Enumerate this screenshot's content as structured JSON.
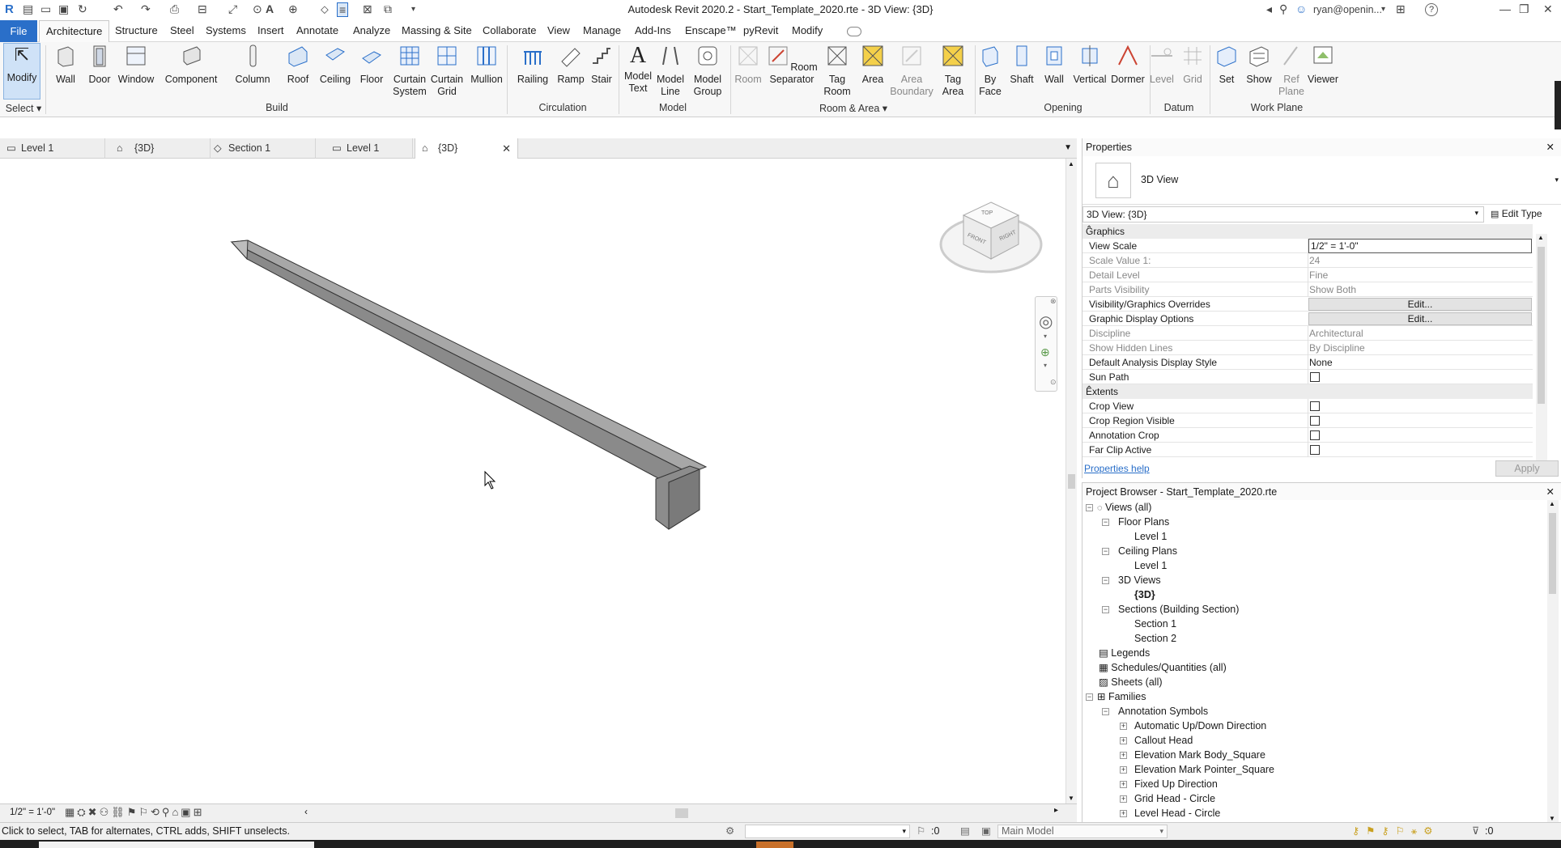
{
  "titlebar": {
    "title": "Autodesk Revit 2020.2 - Start_Template_2020.rte - 3D View: {3D}",
    "user": "ryan@openin...",
    "help": "?"
  },
  "ribbon_tabs": [
    "File",
    "Architecture",
    "Structure",
    "Steel",
    "Systems",
    "Insert",
    "Annotate",
    "Analyze",
    "Massing & Site",
    "Collaborate",
    "View",
    "Manage",
    "Add-Ins",
    "Enscape™",
    "pyRevit",
    "Modify"
  ],
  "tools": {
    "modify": "Modify",
    "wall": "Wall",
    "door": "Door",
    "window": "Window",
    "component": "Component",
    "column": "Column",
    "roof": "Roof",
    "ceiling": "Ceiling",
    "floor": "Floor",
    "curtain_system": "Curtain System",
    "curtain_grid": "Curtain Grid",
    "mullion": "Mullion",
    "railing": "Railing",
    "ramp": "Ramp",
    "stair": "Stair",
    "model_text": "Model Text",
    "model_line": "Model Line",
    "model_group": "Model Group",
    "room": "Room",
    "room_separator": "Room Separator",
    "tag_room": "Tag Room",
    "area": "Area",
    "area_boundary": "Area Boundary",
    "tag_area": "Tag Area",
    "by_face": "By Face",
    "shaft": "Shaft",
    "wall_opening": "Wall",
    "vertical": "Vertical",
    "dormer": "Dormer",
    "level": "Level",
    "grid": "Grid",
    "set": "Set",
    "show": "Show",
    "ref_plane": "Ref Plane",
    "viewer": "Viewer"
  },
  "groups": {
    "select": "Select",
    "build": "Build",
    "circulation": "Circulation",
    "model": "Model",
    "room_area": "Room & Area",
    "opening": "Opening",
    "datum": "Datum",
    "work_plane": "Work Plane"
  },
  "view_tabs": [
    "Level 1",
    "{3D}",
    "Section 1",
    "Level 1",
    "{3D}"
  ],
  "viewcube": {
    "top": "TOP",
    "front": "FRONT",
    "right": "RIGHT"
  },
  "properties": {
    "title": "Properties",
    "type_name": "3D View",
    "selector": "3D View: {3D}",
    "edit_type": "Edit Type",
    "sections": {
      "graphics": "Graphics",
      "extents": "Extents"
    },
    "rows": {
      "view_scale": {
        "k": "View Scale",
        "v": "1/2\" = 1'-0\""
      },
      "scale_value": {
        "k": "Scale Value    1:",
        "v": "24"
      },
      "detail_level": {
        "k": "Detail Level",
        "v": "Fine"
      },
      "parts_visibility": {
        "k": "Parts Visibility",
        "v": "Show Both"
      },
      "vg_overrides": {
        "k": "Visibility/Graphics Overrides",
        "v": "Edit..."
      },
      "graphic_display": {
        "k": "Graphic Display Options",
        "v": "Edit..."
      },
      "discipline": {
        "k": "Discipline",
        "v": "Architectural"
      },
      "show_hidden": {
        "k": "Show Hidden Lines",
        "v": "By Discipline"
      },
      "analysis_style": {
        "k": "Default Analysis Display Style",
        "v": "None"
      },
      "sun_path": {
        "k": "Sun Path"
      },
      "crop_view": {
        "k": "Crop View"
      },
      "crop_region": {
        "k": "Crop Region Visible"
      },
      "annotation_crop": {
        "k": "Annotation Crop"
      },
      "far_clip": {
        "k": "Far Clip Active"
      }
    },
    "help_link": "Properties help",
    "apply": "Apply"
  },
  "browser": {
    "title": "Project Browser - Start_Template_2020.rte",
    "views_all": "Views (all)",
    "floor_plans": "Floor Plans",
    "fp_level1": "Level 1",
    "ceiling_plans": "Ceiling Plans",
    "cp_level1": "Level 1",
    "views_3d": "3D Views",
    "v3d": "{3D}",
    "sections": "Sections (Building Section)",
    "section1": "Section 1",
    "section2": "Section 2",
    "legends": "Legends",
    "schedules": "Schedules/Quantities (all)",
    "sheets": "Sheets (all)",
    "families": "Families",
    "annotation_symbols": "Annotation Symbols",
    "family_items": [
      "Automatic Up/Down Direction",
      "Callout Head",
      "Elevation Mark Body_Square",
      "Elevation Mark Pointer_Square",
      "Fixed Up Direction",
      "Grid Head - Circle",
      "Level Head - Circle"
    ]
  },
  "view_control": {
    "scale": "1/2\" = 1'-0\""
  },
  "status": {
    "message": "Click to select, TAB for alternates, CTRL adds, SHIFT unselects.",
    "worksets": ":0",
    "model": "Main Model",
    "filter": ":0"
  }
}
